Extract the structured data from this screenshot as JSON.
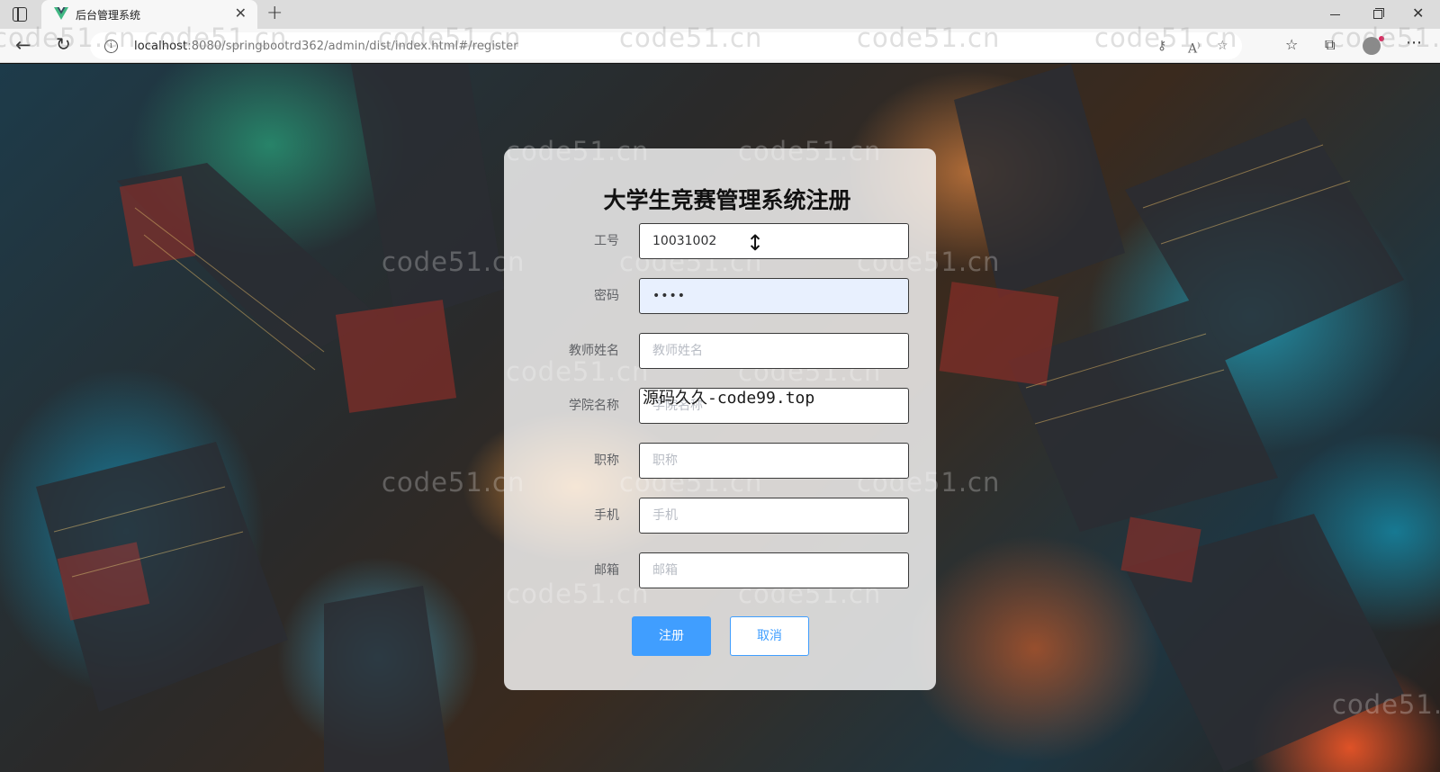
{
  "browser": {
    "tab_title": "后台管理系统",
    "url_host": "localhost",
    "url_rest": ":8080/springbootrd362/admin/dist/index.html#/register",
    "info_icon": "info-icon",
    "colors": {
      "tab_favicon": "#41b883"
    }
  },
  "watermark_text": "code51.cn",
  "overlay_text": "源码久久-code99.top",
  "register": {
    "title": "大学生竞赛管理系统注册",
    "fields": [
      {
        "label": "工号",
        "value": "10031002",
        "placeholder": ""
      },
      {
        "label": "密码",
        "value": "••••",
        "placeholder": ""
      },
      {
        "label": "教师姓名",
        "value": "",
        "placeholder": "教师姓名"
      },
      {
        "label": "学院名称",
        "value": "",
        "placeholder": "学院名称"
      },
      {
        "label": "职称",
        "value": "",
        "placeholder": "职称"
      },
      {
        "label": "手机",
        "value": "",
        "placeholder": "手机"
      },
      {
        "label": "邮箱",
        "value": "",
        "placeholder": "邮箱"
      }
    ],
    "submit_label": "注册",
    "cancel_label": "取消",
    "colors": {
      "primary": "#409eff"
    }
  }
}
